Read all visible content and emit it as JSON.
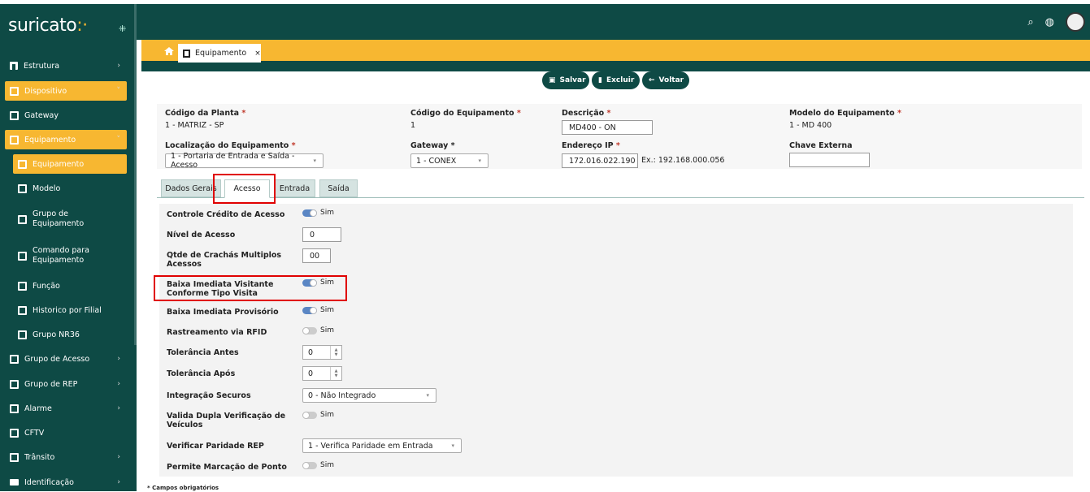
{
  "brand": {
    "logo_text": "suricato",
    "accent": "#f7b731",
    "primary": "#0e4a45"
  },
  "sidebar": {
    "items": [
      {
        "label": "Estrutura"
      },
      {
        "label": "Dispositivo"
      },
      {
        "label": "Gateway"
      },
      {
        "label": "Equipamento"
      },
      {
        "label": "Equipamento"
      },
      {
        "label": "Modelo"
      },
      {
        "label_line1": "Grupo de",
        "label_line2": "Equipamento"
      },
      {
        "label_line1": "Comando para",
        "label_line2": "Equipamento"
      },
      {
        "label": "Função"
      },
      {
        "label": "Historico por Filial"
      },
      {
        "label": "Grupo NR36"
      },
      {
        "label": "Grupo de Acesso"
      },
      {
        "label": "Grupo de REP"
      },
      {
        "label": "Alarme"
      },
      {
        "label": "CFTV"
      },
      {
        "label": "Trânsito"
      },
      {
        "label": "Identificação"
      }
    ]
  },
  "tab": {
    "label": "Equipamento",
    "close": "×"
  },
  "actions": {
    "save": "Salvar",
    "delete": "Excluir",
    "back": "Voltar"
  },
  "form": {
    "planta": {
      "label": "Código da Planta",
      "value": "1 - MATRIZ - SP"
    },
    "codigo": {
      "label": "Código do Equipamento",
      "value": "1"
    },
    "descricao": {
      "label": "Descrição",
      "value": "MD400 - ON"
    },
    "modelo": {
      "label": "Modelo do Equipamento",
      "value": "1 - MD 400"
    },
    "localizacao": {
      "label": "Localização do Equipamento",
      "value": "1 - Portaria de Entrada e Saída - Acesso"
    },
    "gateway": {
      "label": "Gateway",
      "value": "1 - CONEX"
    },
    "ip": {
      "label": "Endereço IP",
      "value": "172.016.022.190",
      "hint": "Ex.: 192.168.000.056"
    },
    "chave": {
      "label": "Chave Externa",
      "value": ""
    },
    "required_mark": "*"
  },
  "subtabs": [
    "Dados Gerais",
    "Acesso",
    "Entrada",
    "Saída"
  ],
  "acesso": {
    "controle_credito": {
      "label": "Controle Crédito de Acesso",
      "toggle": "Sim",
      "on": true
    },
    "nivel": {
      "label": "Nível de Acesso",
      "value": "0"
    },
    "crachas": {
      "label_line1": "Qtde de Crachás Multiplos",
      "label_line2": "Acessos",
      "value": "00"
    },
    "baixa_visitante": {
      "label_line1": "Baixa Imediata Visitante",
      "label_line2": "Conforme Tipo Visita",
      "toggle": "Sim",
      "on": true
    },
    "baixa_provisorio": {
      "label": "Baixa Imediata Provisório",
      "toggle": "Sim",
      "on": true
    },
    "rfid": {
      "label": "Rastreamento via RFID",
      "toggle": "Sim",
      "on": false
    },
    "tol_antes": {
      "label": "Tolerância Antes",
      "value": "0"
    },
    "tol_apos": {
      "label": "Tolerância Após",
      "value": "0"
    },
    "securos": {
      "label": "Integração Securos",
      "value": "0 - Não Integrado"
    },
    "dupla": {
      "label_line1": "Valida Dupla Verificação de",
      "label_line2": "Veículos",
      "toggle": "Sim",
      "on": false
    },
    "paridade": {
      "label": "Verificar Paridade REP",
      "value": "1 - Verifica Paridade em Entrada"
    },
    "ponto": {
      "label": "Permite Marcação de Ponto",
      "toggle": "Sim",
      "on": false
    }
  },
  "footnote": "* Campos obrigatórios"
}
